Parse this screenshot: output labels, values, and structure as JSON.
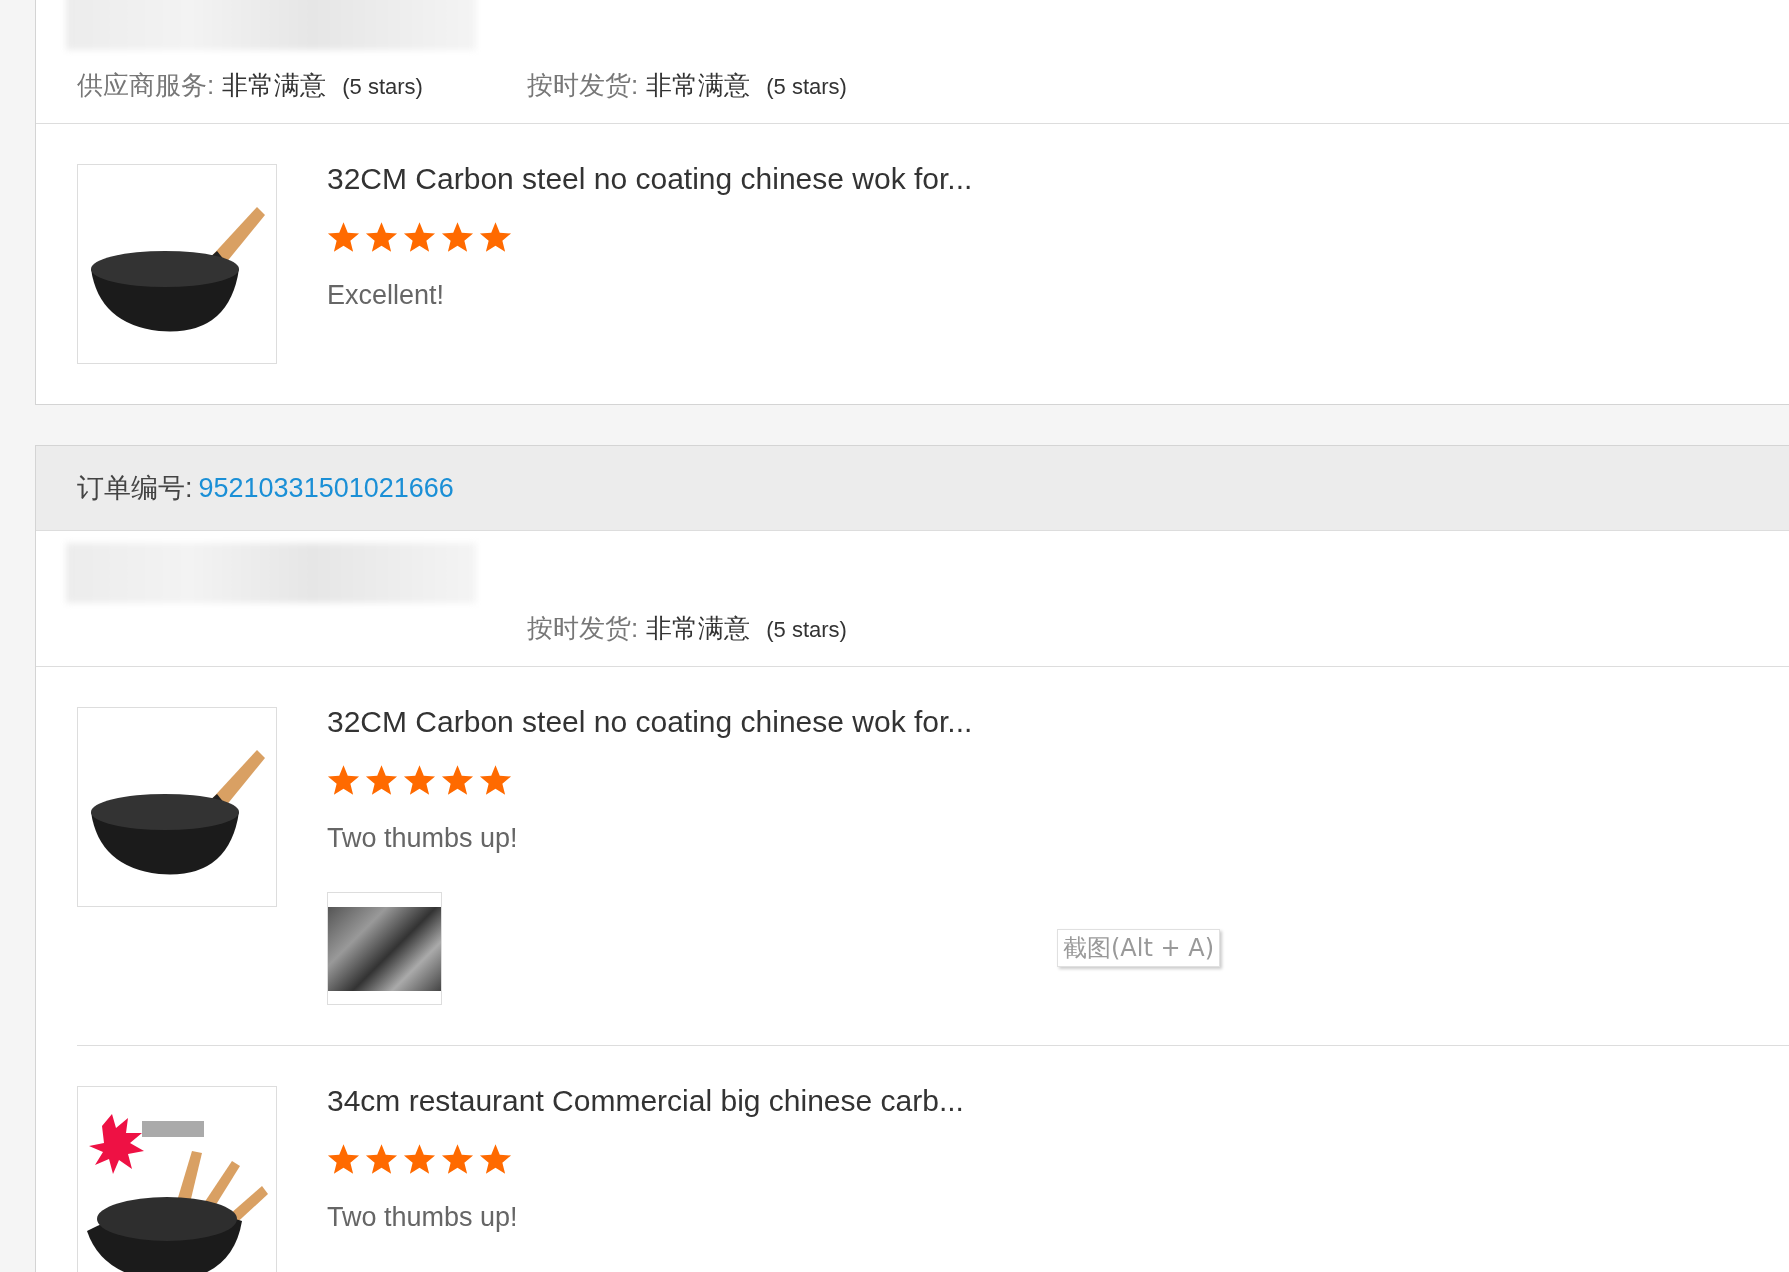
{
  "orders": [
    {
      "redacted": true,
      "ratings": [
        {
          "kind": "supplier",
          "label": "供应商服务:",
          "value": "非常满意",
          "note": "(5 stars)"
        },
        {
          "kind": "shipping",
          "label": "按时发货:",
          "value": "非常满意",
          "note": "(5 stars)"
        }
      ],
      "items": [
        {
          "kind": "wok",
          "title": "32CM Carbon steel no coating chinese wok for...",
          "stars": 5,
          "comment": "Excellent!"
        }
      ]
    },
    {
      "order_label": "订单编号:",
      "order_number": "95210331501021666",
      "redacted": true,
      "ratings": [
        {
          "kind": "shipping",
          "label": "按时发货:",
          "value": "非常满意",
          "note": "(5 stars)"
        }
      ],
      "items": [
        {
          "kind": "wok",
          "title": "32CM Carbon steel no coating chinese wok for...",
          "stars": 5,
          "comment": "Two thumbs up!",
          "photos": [
            {
              "kind": "photo"
            }
          ],
          "tooltip": "截图(Alt + A)"
        },
        {
          "kind": "wok-set",
          "title": "34cm restaurant Commercial big chinese carb...",
          "stars": 5,
          "comment": "Two thumbs up!"
        }
      ]
    }
  ]
}
